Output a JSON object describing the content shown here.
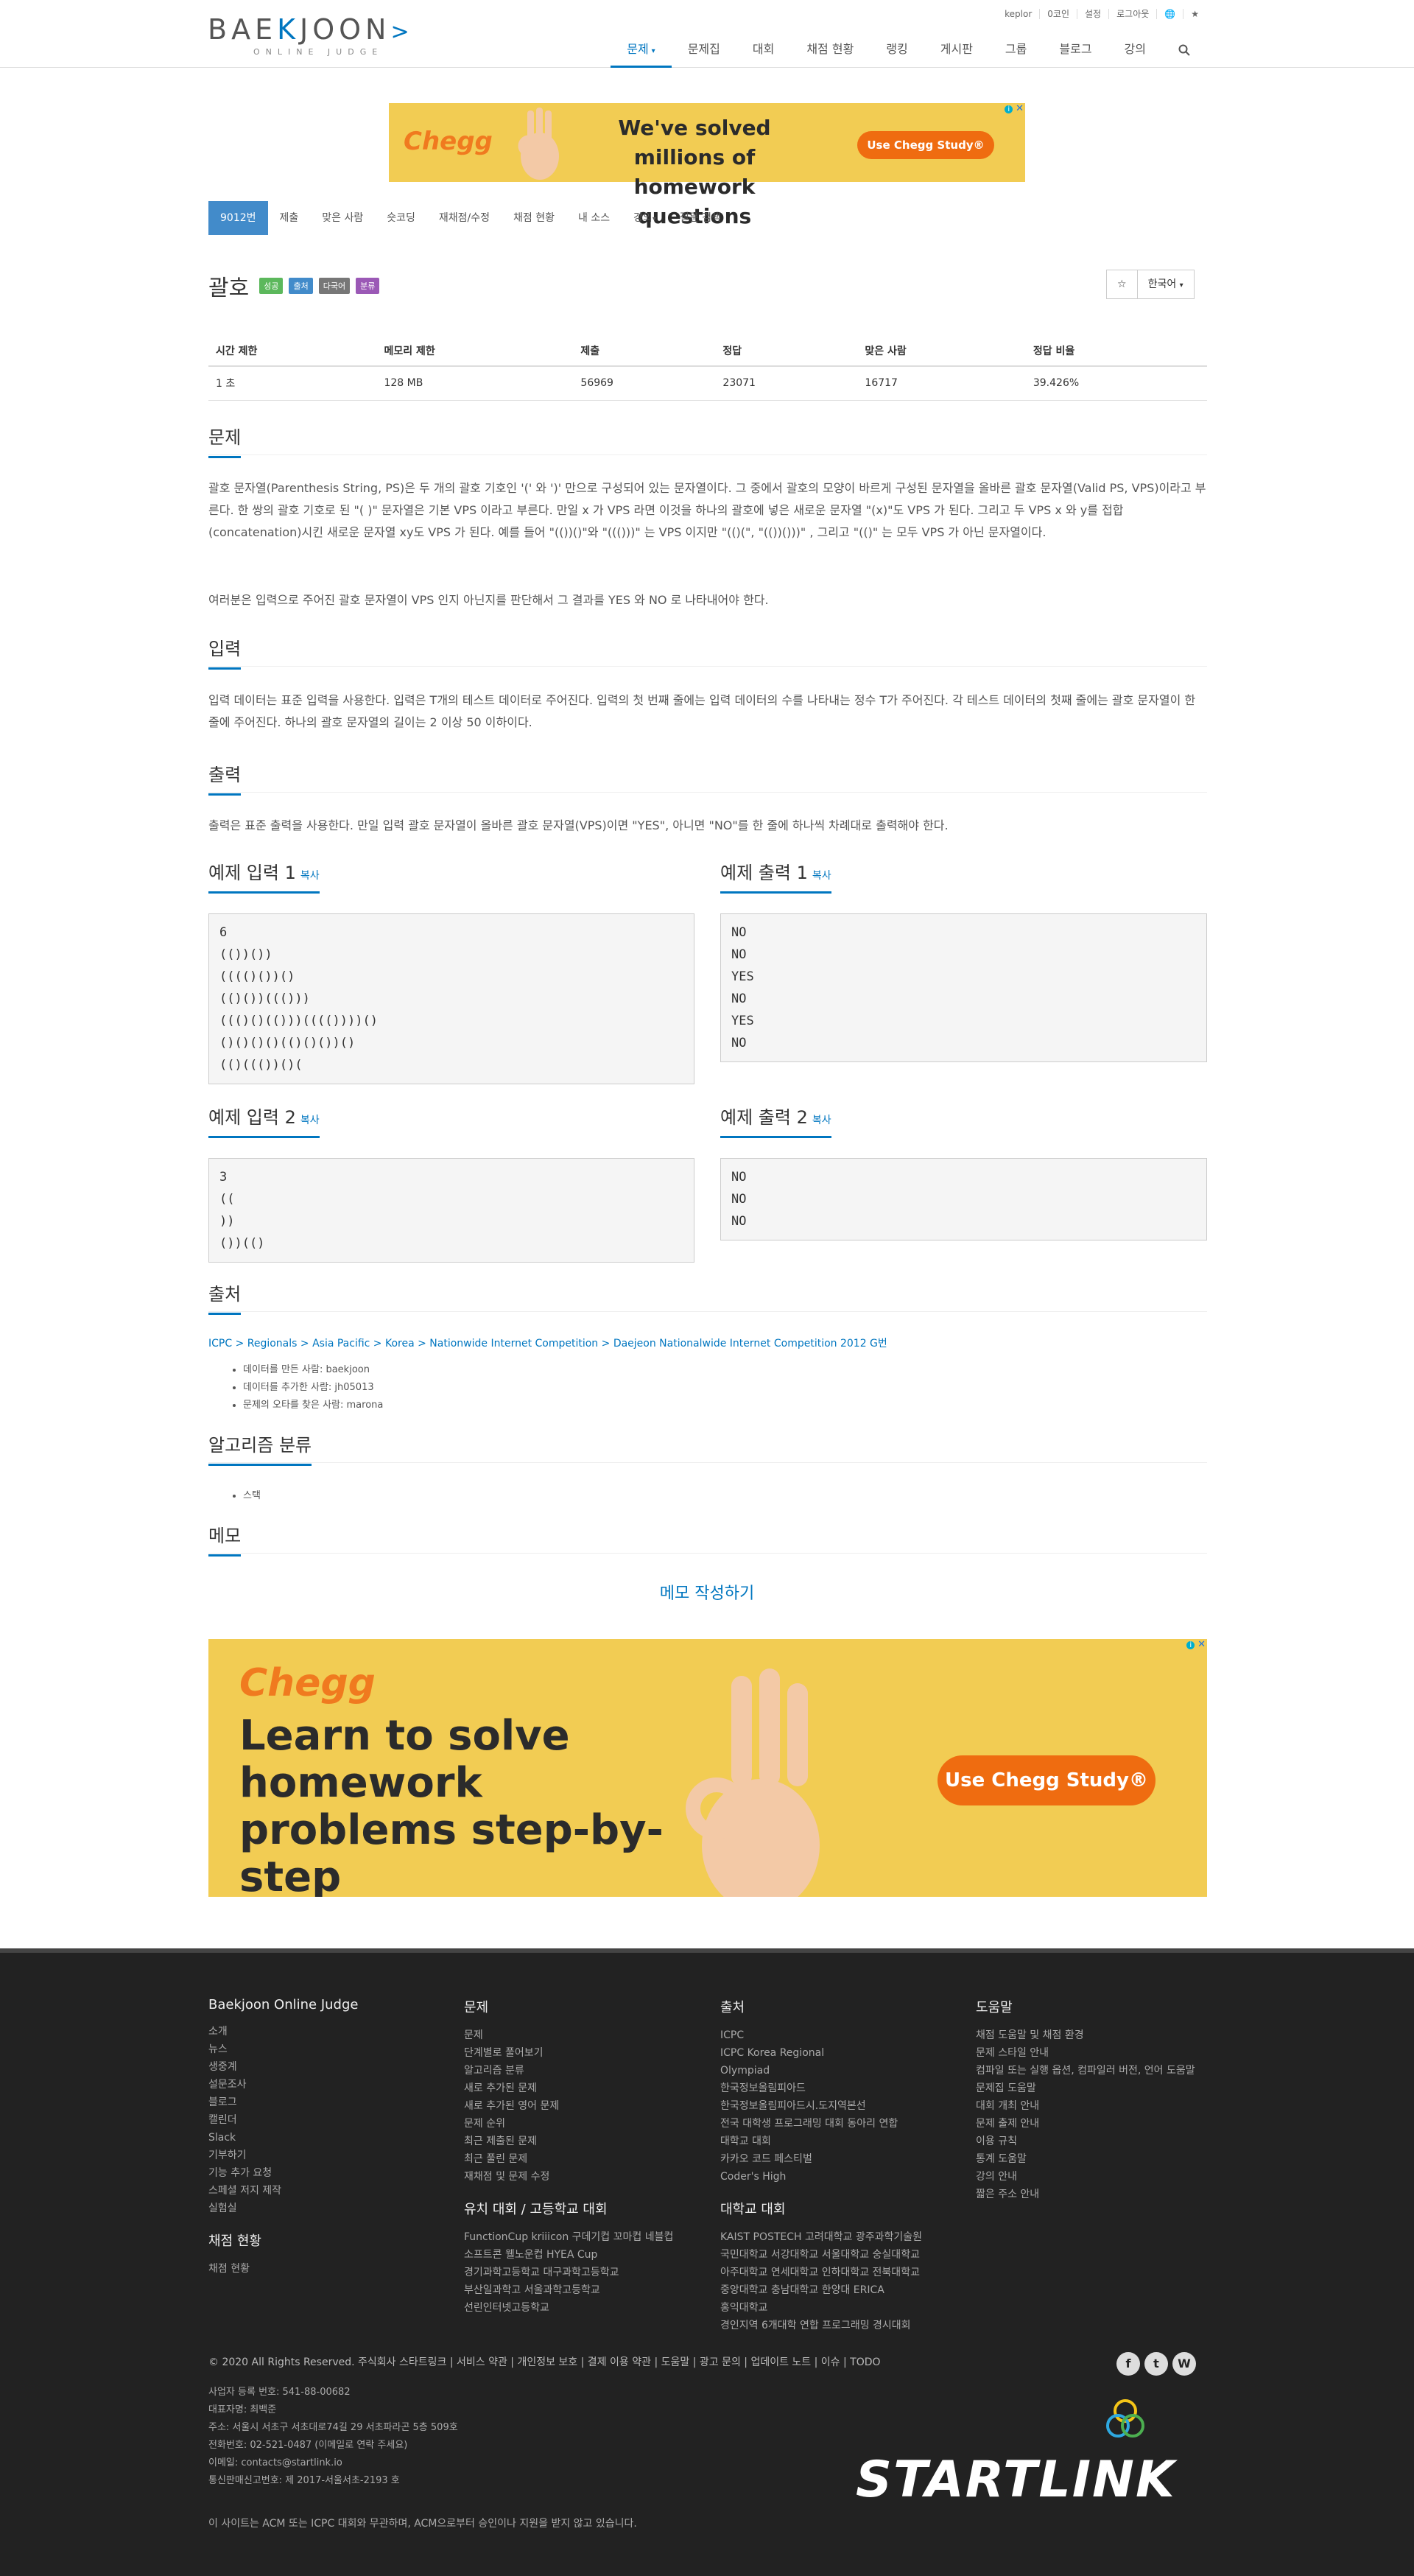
{
  "header": {
    "logo_text": "BAEKJOON",
    "logo_sub": "ONLINE JUDGE",
    "top_links": [
      "keplor",
      "0코인",
      "설정",
      "로그아웃",
      "🌐",
      "★"
    ],
    "nav": [
      {
        "label": "문제",
        "active": true
      },
      {
        "label": "문제집"
      },
      {
        "label": "대회"
      },
      {
        "label": "채점 현황"
      },
      {
        "label": "랭킹"
      },
      {
        "label": "게시판"
      },
      {
        "label": "그룹"
      },
      {
        "label": "블로그"
      },
      {
        "label": "강의"
      }
    ]
  },
  "ad_top": {
    "brand": "Chegg",
    "headline_1": "We've solved millions of",
    "headline_2": "homework questions",
    "cta": "Use Chegg Study®"
  },
  "problem_menu": [
    "9012번",
    "제출",
    "맞은 사람",
    "숏코딩",
    "재채점/수정",
    "채점 현황",
    "내 소스",
    "강의",
    "질문 검색"
  ],
  "problem": {
    "title": "괄호",
    "labels": [
      "성공",
      "출처",
      "다국어",
      "분류"
    ],
    "star": "☆",
    "language": "한국어",
    "info_headers": [
      "시간 제한",
      "메모리 제한",
      "제출",
      "정답",
      "맞은 사람",
      "정답 비율"
    ],
    "info_values": [
      "1 초",
      "128 MB",
      "56969",
      "23071",
      "16717",
      "39.426%"
    ]
  },
  "sections": {
    "description_title": "문제",
    "description_p1": "괄호 문자열(Parenthesis String, PS)은 두 개의 괄호 기호인 '(' 와 ')' 만으로 구성되어 있는 문자열이다. 그 중에서 괄호의 모양이 바르게 구성된 문자열을 올바른 괄호 문자열(Valid PS, VPS)이라고 부른다. 한 쌍의 괄호 기호로 된 \"( )\" 문자열은 기본 VPS 이라고 부른다. 만일 x 가 VPS 라면 이것을 하나의 괄호에 넣은 새로운 문자열 \"(x)\"도 VPS 가 된다. 그리고 두 VPS x 와 y를 접합(concatenation)시킨 새로운 문자열 xy도 VPS 가 된다. 예를 들어 \"(())()\"와 \"((()))\" 는 VPS 이지만 \"(()(\", \"(())()))\" , 그리고 \"(()\" 는 모두 VPS 가 아닌 문자열이다.",
    "description_p2": "여러분은 입력으로 주어진 괄호 문자열이 VPS 인지 아닌지를 판단해서 그 결과를 YES 와 NO 로 나타내어야 한다.",
    "input_title": "입력",
    "input_p": "입력 데이터는 표준 입력을 사용한다. 입력은 T개의 테스트 데이터로 주어진다. 입력의 첫 번째 줄에는 입력 데이터의 수를 나타내는 정수 T가 주어진다. 각 테스트 데이터의 첫째 줄에는 괄호 문자열이 한 줄에 주어진다. 하나의 괄호 문자열의 길이는 2 이상 50 이하이다.",
    "output_title": "출력",
    "output_p": "출력은 표준 출력을 사용한다. 만일 입력 괄호 문자열이 올바른 괄호 문자열(VPS)이면 \"YES\", 아니면 \"NO\"를 한 줄에 하나씩 차례대로 출력해야 한다.",
    "copy_label": "복사",
    "sample_in_1_title": "예제 입력 1",
    "sample_out_1_title": "예제 출력 1",
    "sample_in_2_title": "예제 입력 2",
    "sample_out_2_title": "예제 출력 2",
    "sample_in_1": "6\n(())())\n(((()())()\n(()())((()))\n((()()(()))(((())))()\n()()()()(()()())()\n(()((())()(",
    "sample_out_1": "NO\nNO\nYES\nNO\nYES\nNO",
    "sample_in_2": "3\n((\n))\n())(()",
    "sample_out_2": "NO\nNO\nNO",
    "source_title": "출처",
    "source_path": "ICPC > Regionals > Asia Pacific > Korea > Nationwide Internet Competition > Daejeon Nationalwide Internet Competition 2012 G번",
    "source_bullets": [
      "데이터를 만든 사람: baekjoon",
      "데이터를 추가한 사람: jh05013",
      "문제의 오타를 찾은 사람: marona"
    ],
    "algo_title": "알고리즘 분류",
    "algo_items": [
      "스택"
    ],
    "memo_title": "메모",
    "memo_button": "메모 작성하기"
  },
  "ad_bottom": {
    "brand": "Chegg",
    "headline": "Learn to solve homework problems step-by-step",
    "cta": "Use Chegg Study®"
  },
  "footer": {
    "col1_title": "Baekjoon Online Judge",
    "col1_links": [
      "소개",
      "뉴스",
      "생중계",
      "설문조사",
      "블로그",
      "캘린더",
      "Slack",
      "기부하기",
      "기능 추가 요청",
      "스페셜 저지 제작",
      "실험실"
    ],
    "col1b_title": "채점 현황",
    "col1b_links": [
      "채점 현황"
    ],
    "col2_title": "문제",
    "col2_links": [
      "문제",
      "단계별로 풀어보기",
      "알고리즘 분류",
      "새로 추가된 문제",
      "새로 추가된 영어 문제",
      "문제 순위",
      "최근 제출된 문제",
      "최근 풀린 문제",
      "재채점 및 문제 수정"
    ],
    "col2b_title": "유치 대회 / 고등학교 대회",
    "col2b_links": [
      "FunctionCup kriiicon 구데기컵 꼬마컵 네블컵",
      "소프트콘 웰노운컵 HYEA Cup",
      "경기과학고등학교 대구과학고등학교",
      "부산일과학고 서울과학고등학교",
      "선린인터넷고등학교"
    ],
    "col3_title": "출처",
    "col3_links": [
      "ICPC",
      "ICPC Korea Regional",
      "Olympiad",
      "한국정보올림피아드",
      "한국정보올림피아드시.도지역본선",
      "전국 대학생 프로그래밍 대회 동아리 연합",
      "대학교 대회",
      "카카오 코드 페스티벌",
      "Coder's High"
    ],
    "col3b_title": "대학교 대회",
    "col3b_links": [
      "KAIST POSTECH 고려대학교 광주과학기술원",
      "국민대학교 서강대학교 서울대학교 숭실대학교",
      "아주대학교 연세대학교 인하대학교 전북대학교",
      "중앙대학교 충남대학교 한양대 ERICA",
      "홍익대학교",
      "경인지역 6개대학 연합 프로그래밍 경시대회"
    ],
    "col4_title": "도움말",
    "col4_links": [
      "채점 도움말 및 채점 환경",
      "문제 스타일 안내",
      "컴파일 또는 실행 옵션, 컴파일러 버전, 언어 도움말",
      "문제집 도움말",
      "대회 개최 안내",
      "문제 출제 안내",
      "이용 규칙",
      "통계 도움말",
      "강의 안내",
      "짧은 주소 안내"
    ],
    "bottom_links": "© 2020 All Rights Reserved. 주식회사 스타트링크 | 서비스 약관 | 개인정보 보호 | 결제 이용 약관 | 도움말 | 광고 문의 | 업데이트 노트 | 이슈 | TODO",
    "biz_info": [
      "사업자 등록 번호: 541-88-00682",
      "대표자명: 최백준",
      "주소: 서울시 서초구 서초대로74길 29 서초파라곤 5층 509호",
      "전화번호: 02-521-0487 (이메일로 연락 주세요)",
      "이메일: contacts@startlink.io",
      "통신판매신고번호: 제 2017-서울서초-2193 호"
    ],
    "note": "이 사이트는 ACM 또는 ICPC 대회와 무관하며, ACM으로부터 승인이나 지원을 받지 않고 있습니다.",
    "company_logo": "STARTLINK"
  }
}
